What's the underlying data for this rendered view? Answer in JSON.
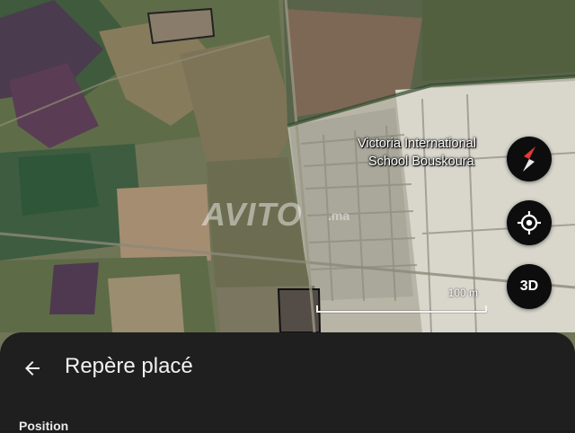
{
  "map": {
    "place_label_line1": "Victoria International",
    "place_label_line2": "School Bouskoura",
    "scale_label": "100 m",
    "watermark": "AVITO",
    "watermark_suffix": ".ma"
  },
  "controls": {
    "compass_icon": "compass-icon",
    "location_icon": "my-location-icon",
    "three_d_label": "3D"
  },
  "sheet": {
    "back_icon": "arrow-left-icon",
    "title": "Repère placé",
    "section_label": "Position"
  },
  "colors": {
    "sheet_bg": "#1f1f1f",
    "fab_bg": "#0d0d0d",
    "compass_red": "#e53935"
  }
}
